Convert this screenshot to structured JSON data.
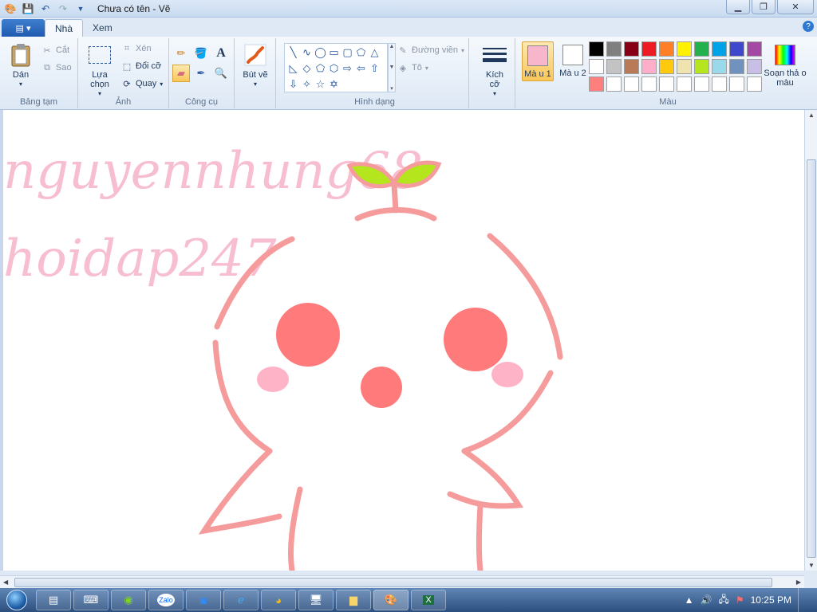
{
  "window": {
    "title": "Chưa có tên - Vẽ"
  },
  "tabs": {
    "home": "Nhà",
    "view": "Xem"
  },
  "clipboard": {
    "paste": "Dán",
    "cut": "Cắt",
    "copy": "Sao",
    "label": "Bảng tạm"
  },
  "image": {
    "select": "Lựa chọn",
    "crop": "Xén",
    "resize": "Đổi cỡ",
    "rotate": "Quay",
    "label": "Ảnh"
  },
  "tools": {
    "label": "Công cụ",
    "text_tool": "A"
  },
  "brushes": {
    "label": "Bút vẽ"
  },
  "shapes": {
    "label": "Hình dạng",
    "outline": "Đường viền",
    "fill": "Tô"
  },
  "size": {
    "label": "Kích cỡ"
  },
  "colors": {
    "color1": "Mà u 1",
    "color2": "Mà u 2",
    "edit": "Soạn thả o màu",
    "label": "Màu",
    "color1_value": "#f7b6cb",
    "color2_value": "#ffffff",
    "palette_row1": [
      "#000000",
      "#7f7f7f",
      "#880015",
      "#ed1c24",
      "#ff7f27",
      "#fff200",
      "#22b14c",
      "#00a2e8",
      "#3f48cc",
      "#a349a4"
    ],
    "palette_row2": [
      "#ffffff",
      "#c3c3c3",
      "#b97a57",
      "#ffaec9",
      "#ffc90e",
      "#efe4b0",
      "#b5e61d",
      "#99d9ea",
      "#7092be",
      "#c8bfe7"
    ],
    "palette_row3": [
      "#ff7f7f",
      "#ffffff",
      "#ffffff",
      "#ffffff",
      "#ffffff",
      "#ffffff",
      "#ffffff",
      "#ffffff",
      "#ffffff",
      "#ffffff"
    ]
  },
  "drawing": {
    "watermark1": "nguyennhung68",
    "watermark2": "hoidap247",
    "stroke_color": "#f59b9b",
    "eye_color": "#ff7a7a",
    "blush_color": "#ffb3c6",
    "leaf_color": "#b5e61d"
  },
  "taskbar": {
    "time": "10:25 PM"
  }
}
